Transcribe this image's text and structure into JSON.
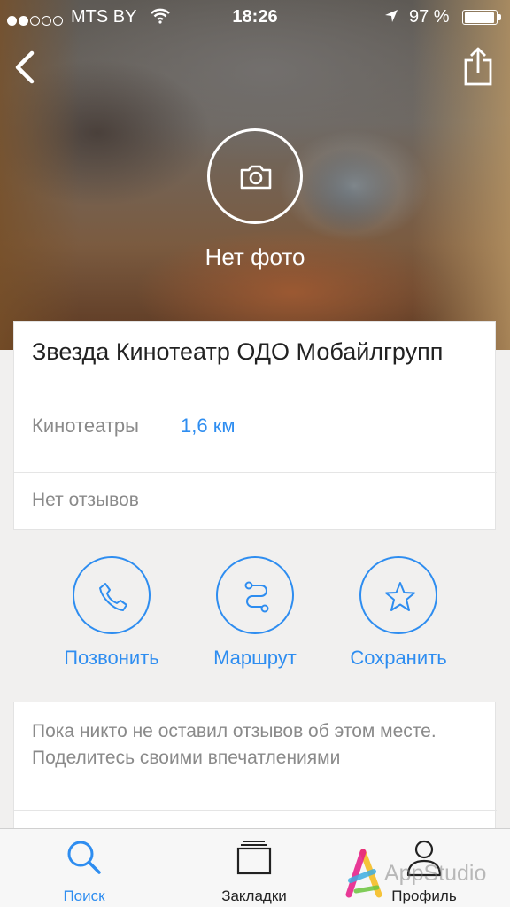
{
  "status_bar": {
    "carrier": "MTS BY",
    "time": "18:26",
    "battery_percent": "97 %",
    "signal_bars_filled": 2,
    "signal_bars_total": 5
  },
  "header": {
    "no_photo_label": "Нет фото"
  },
  "place": {
    "title": "Звезда Кинотеатр ОДО Мобайлгрупп",
    "category": "Кинотеатры",
    "distance": "1,6 км",
    "reviews_status": "Нет отзывов"
  },
  "actions": {
    "call_label": "Позвонить",
    "route_label": "Маршрут",
    "save_label": "Сохранить"
  },
  "reviews_prompt": {
    "text": "Пока никто не оставил отзывов об этом месте. Поделитесь своими впечатлениями"
  },
  "tab_bar": {
    "tabs": [
      {
        "label": "Поиск",
        "icon": "search-icon",
        "active": true
      },
      {
        "label": "Закладки",
        "icon": "bookmarks-icon",
        "active": false
      },
      {
        "label": "Профиль",
        "icon": "profile-icon",
        "active": false
      }
    ]
  },
  "watermark": {
    "text": "AppStudio"
  },
  "colors": {
    "accent": "#2e8df0",
    "background": "#f1f0ef",
    "secondary_text": "#8a8a8a"
  }
}
